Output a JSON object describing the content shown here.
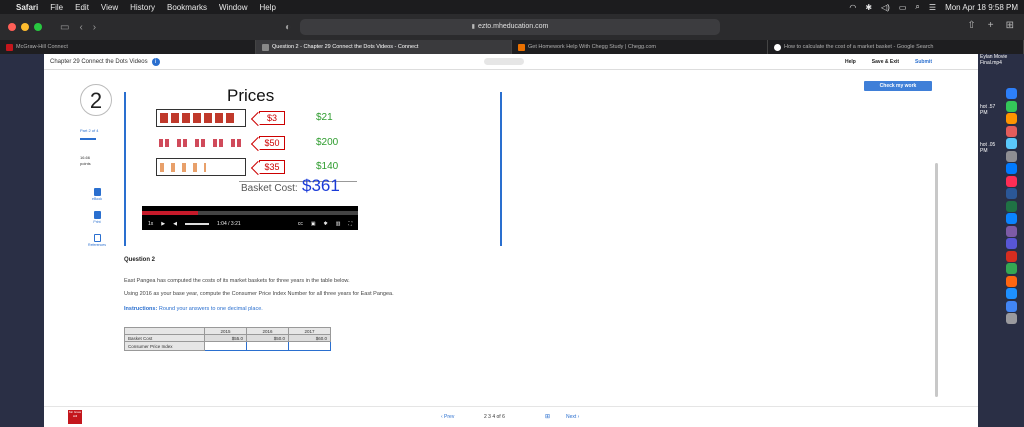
{
  "menubar": {
    "apple": "",
    "items": [
      "Safari",
      "File",
      "Edit",
      "View",
      "History",
      "Bookmarks",
      "Window",
      "Help"
    ],
    "datetime": "Mon Apr 18  9:58 PM"
  },
  "browser": {
    "url": "ezto.mheducation.com",
    "tabs": [
      {
        "label": "McGraw-Hill Connect",
        "color": "#c4161c"
      },
      {
        "label": "Question 2 - Chapter 29 Connect the Dots Videos - Connect",
        "color": "#555555"
      },
      {
        "label": "Get Homework Help With Chegg Study | Chegg.com",
        "color": "#eb7100"
      },
      {
        "label": "How to calculate the cost of a market basket - Google Search",
        "color": "#ffffff"
      }
    ]
  },
  "connect": {
    "assignment_title": "Chapter 29 Connect the Dots Videos",
    "actions": {
      "help": "Help",
      "save_exit": "Save & Exit",
      "submit": "Submit"
    },
    "check_button": "Check my work",
    "question_number": "2",
    "part": "Part 2 of 4",
    "points": "16.66",
    "points_label": "points",
    "sidebar": [
      {
        "label": "eBook"
      },
      {
        "label": "Print"
      },
      {
        "label": "References"
      }
    ]
  },
  "video": {
    "title": "Prices",
    "rows": [
      {
        "price": "$3",
        "value": "$21"
      },
      {
        "price": "$50",
        "value": "$200"
      },
      {
        "price": "$35",
        "value": "$140"
      }
    ],
    "basket_label": "Basket Cost:",
    "basket_total": "$361",
    "speed": "1x",
    "time": "1:04 / 3:21",
    "cc": "cc",
    "progress": 0.26
  },
  "question": {
    "heading": "Question 2",
    "line1": "East Pangea has computed the costs of its market baskets for three years in the table below.",
    "line2": "Using 2016 as your base year, compute the Consumer Price Index Number for all three years for East Pangea.",
    "instructions_label": "Instructions:",
    "instructions": "Round your answers to one decimal place.",
    "table": {
      "years": [
        "2015",
        "2016",
        "2017"
      ],
      "rows": [
        {
          "label": "Basket Cost",
          "values": [
            "$55.0",
            "$50.0",
            "$60.0"
          ]
        },
        {
          "label": "Consumer Price Index",
          "values": [
            "",
            "",
            ""
          ]
        }
      ]
    }
  },
  "footer": {
    "prev": "‹ Prev",
    "pages": "2  3  4  of 6",
    "next": "Next ›",
    "logo": "Mc Graw Hill"
  },
  "desktop": {
    "file_top": "Eylan Movie Final.mp4",
    "snippet1": "hot .57 PM",
    "snippet2": "hot .05 PM"
  }
}
